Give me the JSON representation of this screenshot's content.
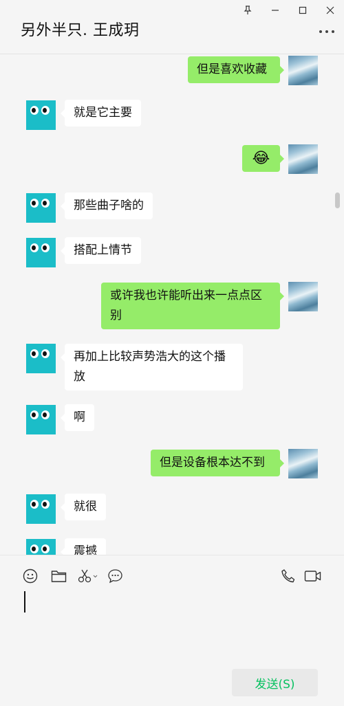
{
  "header": {
    "title": "另外半只. 王成玥"
  },
  "window_controls": [
    "pin-icon",
    "minimize-icon",
    "maximize-icon",
    "close-icon"
  ],
  "messages": [
    {
      "side": "out",
      "text": "但是喜欢收藏"
    },
    {
      "side": "in",
      "text": "就是它主要"
    },
    {
      "side": "out",
      "text": "😂"
    },
    {
      "side": "in",
      "text": "那些曲子啥的"
    },
    {
      "side": "in",
      "text": "搭配上情节"
    },
    {
      "side": "out",
      "text": "或许我也许能听出来一点点区别"
    },
    {
      "side": "in",
      "text": "再加上比较声势浩大的这个播放"
    },
    {
      "side": "in",
      "text": "啊"
    },
    {
      "side": "out",
      "text": "但是设备根本达不到"
    },
    {
      "side": "in",
      "text": "就很"
    },
    {
      "side": "in",
      "text": "震撼"
    }
  ],
  "toolbar": {
    "icons": [
      "emoji-icon",
      "folder-icon",
      "scissors-icon",
      "chat-history-icon",
      "phone-icon",
      "video-icon"
    ],
    "send_label": "发送(S)"
  },
  "colors": {
    "out_bubble": "#95ec69",
    "in_bubble": "#ffffff",
    "send_text": "#07c160"
  }
}
